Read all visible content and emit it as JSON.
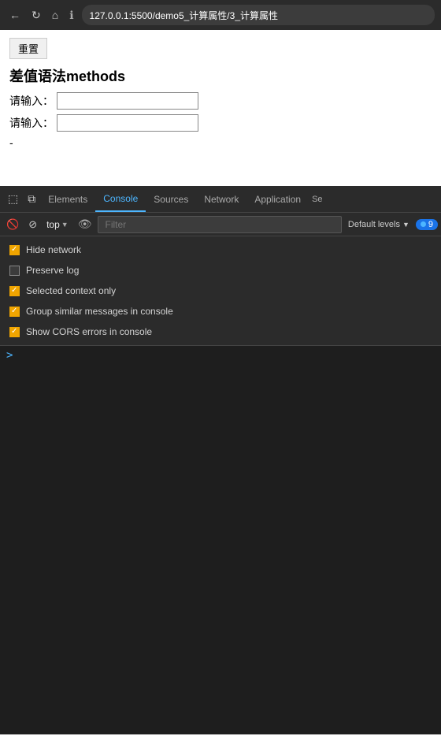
{
  "browser": {
    "back_label": "←",
    "forward_label": "→",
    "reload_label": "↻",
    "home_label": "⌂",
    "info_label": "ℹ",
    "address": "127.0.0.1:5500/demo5_计算属性/3_计算属性"
  },
  "page": {
    "reload_btn_label": "重置",
    "title": "差值语法methods",
    "input1_label": "请输入：",
    "input1_value": "",
    "input2_label": "请输入：",
    "input2_value": "",
    "dash": "-"
  },
  "devtools": {
    "tabs": [
      {
        "label": "Elements",
        "active": false
      },
      {
        "label": "Console",
        "active": true
      },
      {
        "label": "Sources",
        "active": false
      },
      {
        "label": "Network",
        "active": false
      },
      {
        "label": "Application",
        "active": false
      },
      {
        "label": "Se",
        "active": false
      }
    ],
    "toolbar": {
      "top_label": "top",
      "filter_placeholder": "Filter",
      "default_levels_label": "Default levels",
      "badge_count": "9"
    },
    "options": [
      {
        "label": "Hide network",
        "checked": true
      },
      {
        "label": "Preserve log",
        "checked": false
      },
      {
        "label": "Selected context only",
        "checked": true
      },
      {
        "label": "Group similar messages in console",
        "checked": true
      },
      {
        "label": "Show CORS errors in console",
        "checked": true
      }
    ],
    "console_prompt": ">"
  }
}
